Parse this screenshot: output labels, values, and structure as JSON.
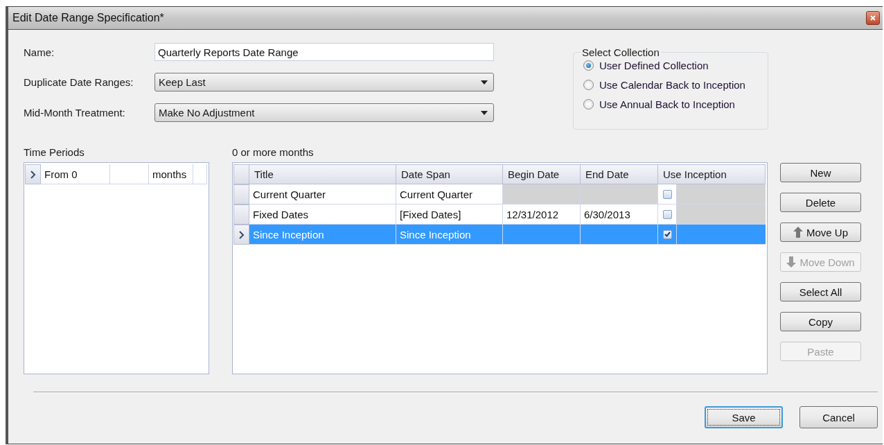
{
  "window": {
    "title": "Edit Date Range Specification*"
  },
  "form": [
    {
      "kind": "text",
      "label": "Name:",
      "value": "Quarterly Reports Date Range"
    },
    {
      "kind": "dropdown",
      "label": "Duplicate Date Ranges:",
      "value": "Keep Last"
    },
    {
      "kind": "dropdown",
      "label": "Mid-Month Treatment:",
      "value": "Make No Adjustment"
    }
  ],
  "select_collection": {
    "title": "Select Collection",
    "options": [
      {
        "label": "User Defined Collection",
        "selected": true
      },
      {
        "label": "Use Calendar Back to Inception",
        "selected": false
      },
      {
        "label": "Use Annual Back to Inception",
        "selected": false
      }
    ]
  },
  "time_periods": {
    "title": "Time Periods",
    "rows": [
      {
        "from": "From 0",
        "unit": "months",
        "selected": true
      }
    ]
  },
  "date_ranges": {
    "caption": "0 or more months",
    "columns": [
      "Title",
      "Date Span",
      "Begin Date",
      "End Date",
      "Use Inception"
    ],
    "rows": [
      {
        "title": "Current Quarter",
        "date_span": "Current Quarter",
        "dates_disabled": true,
        "use_inception": false,
        "selected": false
      },
      {
        "title": "Fixed Dates",
        "date_span": "[Fixed Dates]",
        "begin_date": "12/31/2012",
        "end_date": "6/30/2013",
        "dates_disabled": false,
        "use_inception": false,
        "selected": false
      },
      {
        "title": "Since Inception",
        "date_span": "Since Inception",
        "use_inception": true,
        "selected": true
      }
    ]
  },
  "side_buttons": [
    {
      "label": "New",
      "kind": "plain",
      "disabled": false
    },
    {
      "label": "Delete",
      "kind": "plain",
      "disabled": false
    },
    {
      "label": "Move Up",
      "kind": "move_up",
      "disabled": false
    },
    {
      "label": "Move Down",
      "kind": "move_down",
      "disabled": true
    },
    {
      "label": "Select All",
      "kind": "plain",
      "disabled": false
    },
    {
      "label": "Copy",
      "kind": "plain",
      "disabled": false
    },
    {
      "label": "Paste",
      "kind": "plain",
      "disabled": true
    }
  ],
  "footer_buttons": [
    {
      "label": "Save",
      "focused": true
    },
    {
      "label": "Cancel",
      "focused": false
    }
  ]
}
